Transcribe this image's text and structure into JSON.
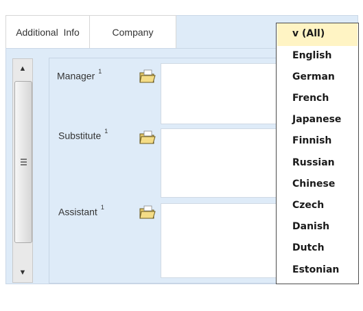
{
  "tabs": [
    {
      "label": "Additional  Info"
    },
    {
      "label": "Company"
    }
  ],
  "fields": [
    {
      "label": "Manager",
      "marker": "1",
      "value": ""
    },
    {
      "label": "Substitute",
      "marker": "1",
      "value": ""
    },
    {
      "label": "Assistant",
      "marker": "1",
      "value": ""
    }
  ],
  "scrollbar": {
    "up_icon": "▲",
    "down_icon": "▼"
  },
  "language_dropdown": {
    "selected": "v (All)",
    "options": [
      "v (All)",
      "English",
      "German",
      "French",
      "Japanese",
      "Finnish",
      "Russian",
      "Chinese",
      "Czech",
      "Danish",
      "Dutch",
      "Estonian"
    ]
  },
  "colors": {
    "panel_bg": "#deebf8",
    "selected_option_bg": "#fff4c4"
  }
}
